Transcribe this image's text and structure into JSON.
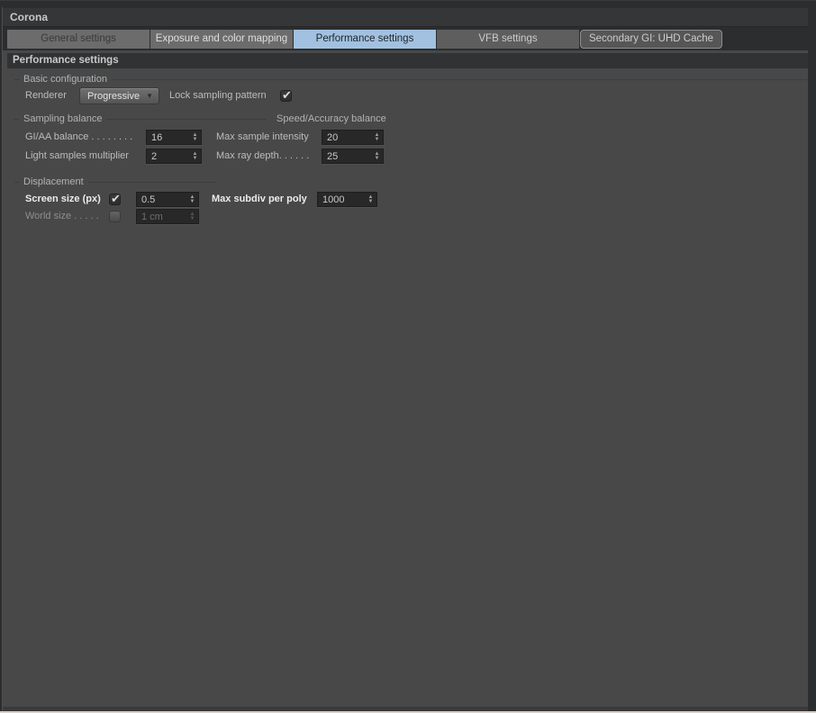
{
  "window": {
    "title": "Corona"
  },
  "colors": {
    "active_tab": "#a2c1e0",
    "content_bg": "#484848",
    "field_bg": "#282828"
  },
  "icons": {
    "check": "✔",
    "dropdown_arrow": "▼",
    "spinner_up": "▲",
    "spinner_down": "▼"
  },
  "tabs": [
    {
      "label": "General settings",
      "active": false
    },
    {
      "label": "Exposure and color mapping",
      "active": false
    },
    {
      "label": "Performance settings",
      "active": true
    },
    {
      "label": "VFB settings",
      "active": false
    },
    {
      "label": "Secondary GI: UHD Cache",
      "active": false
    }
  ],
  "section": {
    "header": "Performance settings"
  },
  "basic": {
    "title": "Basic configuration",
    "renderer_label": "Renderer",
    "renderer_value": "Progressive",
    "lock_sampling_label": "Lock sampling pattern",
    "lock_sampling_checked": true
  },
  "sampling": {
    "title": "Sampling balance",
    "gi_aa_label": "GI/AA balance . . . . . . . .",
    "gi_aa_value": "16",
    "light_samples_label": "Light samples multiplier",
    "light_samples_value": "2"
  },
  "speed": {
    "title": "Speed/Accuracy balance",
    "max_sample_intensity_label": "Max sample intensity",
    "max_sample_intensity_value": "20",
    "max_ray_depth_label": "Max ray depth. . . . . .",
    "max_ray_depth_value": "25"
  },
  "displacement": {
    "title": "Displacement",
    "screen_size_label": "Screen size (px)",
    "screen_size_checked": true,
    "screen_size_value": "0.5",
    "world_size_label": "World size . . . . .",
    "world_size_checked": false,
    "world_size_value": "1 cm",
    "max_subdiv_label": "Max subdiv per poly",
    "max_subdiv_value": "1000"
  }
}
